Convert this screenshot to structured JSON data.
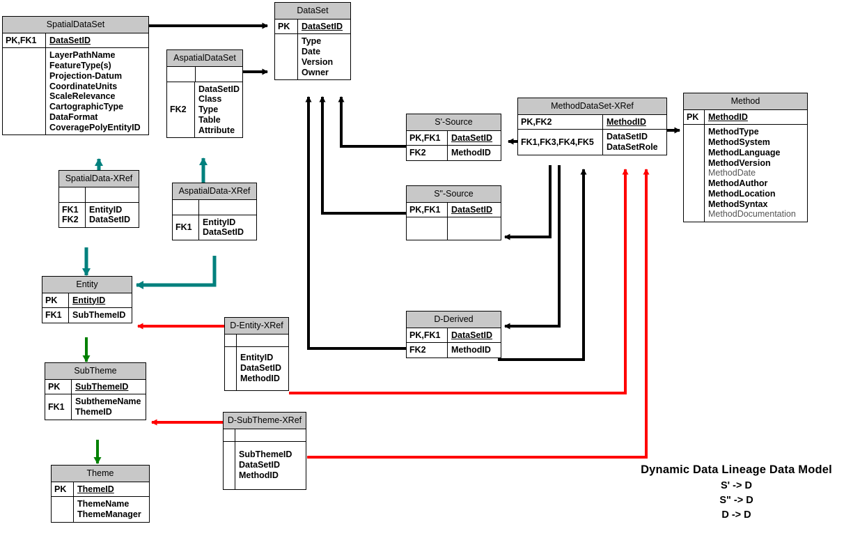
{
  "diagram": {
    "title": "Dynamic Data Lineage Data Model",
    "legend_lines": [
      "S'  -> D",
      "S\" -> D",
      "D  -> D"
    ],
    "colors": {
      "black": "#000000",
      "red": "#ff0000",
      "green": "#008000",
      "teal": "#00807d",
      "header_fill": "#c8c8c8",
      "body_fill": "#ffffff"
    }
  },
  "entities": {
    "spatial_dataset": {
      "title": "SpatialDataSet",
      "pk_keys": "PK,FK1",
      "pk_attrs": "DataSetID",
      "fk_keys": "",
      "attrs": [
        "LayerPathName",
        "FeatureType(s)",
        "Projection-Datum",
        "CoordinateUnits",
        "ScaleRelevance",
        "CartographicType",
        "DataFormat",
        "CoveragePolyEntityID"
      ]
    },
    "aspatial_dataset": {
      "title": "AspatialDataSet",
      "pk_keys": "",
      "pk_attrs": "",
      "fk_keys": "FK2",
      "attrs": [
        "DataSetID",
        "Class",
        "Type",
        "Table",
        "Attribute"
      ]
    },
    "dataset": {
      "title": "DataSet",
      "pk_keys": "PK",
      "pk_attrs": "DataSetID",
      "fk_keys": "",
      "attrs": [
        "Type",
        "Date",
        "Version",
        "Owner"
      ]
    },
    "spatialdata_xref": {
      "title": "SpatialData-XRef",
      "pk_keys": "",
      "pk_attrs": "",
      "fk_keys": "FK1\nFK2",
      "attrs": [
        "EntityID",
        "DataSetID"
      ]
    },
    "aspatialdata_xref": {
      "title": "AspatialData-XRef",
      "pk_keys": "",
      "pk_attrs": "",
      "fk_keys": "FK1",
      "attrs": [
        "EntityID",
        "DataSetID"
      ]
    },
    "s_prime_source": {
      "title": "S'-Source",
      "pk_keys": "PK,FK1",
      "pk_attrs": "DataSetID",
      "fk_keys": "FK2",
      "attrs": [
        "MethodID"
      ]
    },
    "s_double_source": {
      "title": "S\"-Source",
      "pk_keys": "PK,FK1",
      "pk_attrs": "DataSetID",
      "fk_keys": "",
      "attrs": []
    },
    "d_derived": {
      "title": "D-Derived",
      "pk_keys": "PK,FK1",
      "pk_attrs": "DataSetID",
      "fk_keys": "FK2",
      "attrs": [
        "MethodID"
      ]
    },
    "method_dataset_xref": {
      "title": "MethodDataSet-XRef",
      "pk_keys": "PK,FK2",
      "pk_attrs": "MethodID",
      "fk_keys": "FK1,FK3,FK4,FK5",
      "attrs": [
        "DataSetID",
        "DataSetRole"
      ]
    },
    "method": {
      "title": "Method",
      "pk_keys": "PK",
      "pk_attrs": "MethodID",
      "fk_keys": "",
      "attrs": [
        "MethodType",
        "MethodSystem",
        "MethodLanguage",
        "MethodVersion",
        "MethodDate",
        "MethodAuthor",
        "MethodLocation",
        "MethodSyntax",
        "MethodDocumentation"
      ],
      "faint_attrs": [
        "MethodDate",
        "MethodDocumentation"
      ]
    },
    "entity": {
      "title": "Entity",
      "pk_keys": "PK",
      "pk_attrs": "EntityID",
      "fk_keys": "FK1",
      "attrs": [
        "SubThemeID"
      ]
    },
    "subtheme": {
      "title": "SubTheme",
      "pk_keys": "PK",
      "pk_attrs": "SubThemeID",
      "fk_keys": "FK1",
      "attrs": [
        "SubthemeName",
        "ThemeID"
      ]
    },
    "theme": {
      "title": "Theme",
      "pk_keys": "PK",
      "pk_attrs": "ThemeID",
      "fk_keys": "",
      "attrs": [
        "ThemeName",
        "ThemeManager"
      ]
    },
    "d_entity_xref": {
      "title": "D-Entity-XRef",
      "pk_keys": "",
      "pk_attrs": "",
      "fk_keys": "",
      "attrs": [
        "EntityID",
        "DataSetID",
        "MethodID"
      ]
    },
    "d_subtheme_xref": {
      "title": "D-SubTheme-XRef",
      "pk_keys": "",
      "pk_attrs": "",
      "fk_keys": "",
      "attrs": [
        "SubThemeID",
        "DataSetID",
        "MethodID"
      ]
    }
  }
}
